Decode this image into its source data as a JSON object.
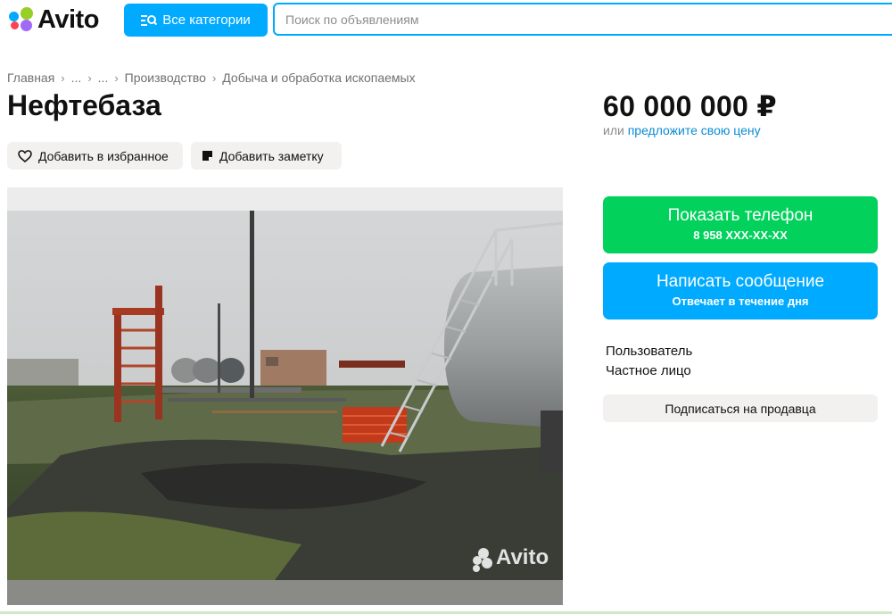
{
  "header": {
    "logo_text": "Avito",
    "categories_button": "Все категории",
    "search_placeholder": "Поиск по объявлениям"
  },
  "breadcrumbs": [
    "Главная",
    "...",
    "...",
    "Производство",
    "Добыча и обработка ископаемых"
  ],
  "listing": {
    "title": "Нефтебаза",
    "add_favorite": "Добавить в избранное",
    "add_note": "Добавить заметку",
    "photo_watermark": "Avito"
  },
  "price": {
    "value": "60 000 000 ₽",
    "prefix": "или",
    "offer_link": "предложите свою цену"
  },
  "contact": {
    "show_phone": "Показать телефон",
    "phone_masked": "8 958 XXX-XX-XX",
    "write_message": "Написать сообщение",
    "response_time": "Отвечает в течение дня"
  },
  "seller": {
    "name": "Пользователь",
    "type": "Частное лицо",
    "subscribe": "Подписаться на продавца"
  },
  "colors": {
    "blue": "#00aaff",
    "green": "#02d15c",
    "link": "#0a8cd6"
  }
}
